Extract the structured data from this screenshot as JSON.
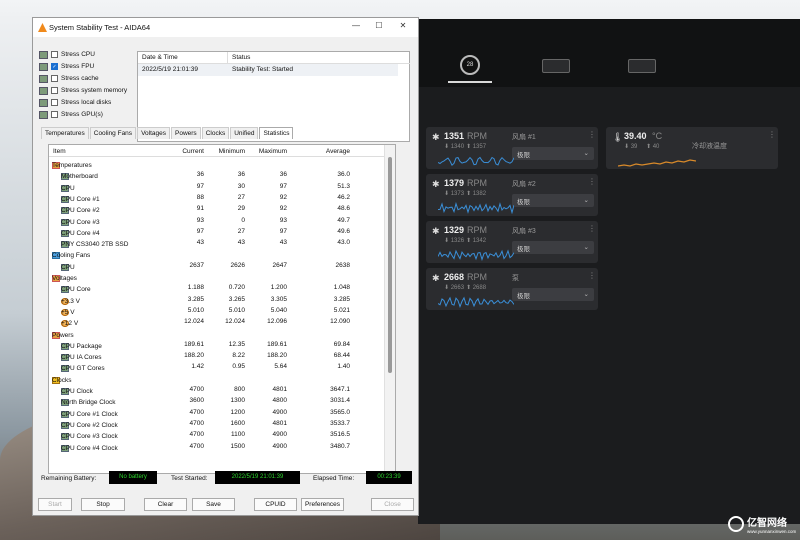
{
  "window": {
    "title": "System Stability Test - AIDA64",
    "min": "—",
    "max": "☐",
    "close": "✕"
  },
  "stress_options": [
    {
      "label": "Stress CPU",
      "checked": false
    },
    {
      "label": "Stress FPU",
      "checked": true
    },
    {
      "label": "Stress cache",
      "checked": false
    },
    {
      "label": "Stress system memory",
      "checked": false
    },
    {
      "label": "Stress local disks",
      "checked": false
    },
    {
      "label": "Stress GPU(s)",
      "checked": false
    }
  ],
  "status_table": {
    "h_date": "Date & Time",
    "h_status": "Status",
    "date": "2022/5/19 21:01:39",
    "status": "Stability Test: Started"
  },
  "tabs": [
    "Temperatures",
    "Cooling Fans",
    "Voltages",
    "Powers",
    "Clocks",
    "Unified",
    "Statistics"
  ],
  "active_tab": "Statistics",
  "grid_headers": {
    "item": "Item",
    "current": "Current",
    "minimum": "Minimum",
    "maximum": "Maximum",
    "average": "Average"
  },
  "rows": [
    {
      "kind": "section",
      "icon": "thermometer-icon",
      "name": "Temperatures"
    },
    {
      "kind": "item",
      "icon": "motherboard-icon",
      "name": "Motherboard",
      "cur": "36",
      "min": "36",
      "max": "36",
      "avg": "36.0"
    },
    {
      "kind": "item",
      "icon": "cpu-icon",
      "name": "CPU",
      "cur": "97",
      "min": "30",
      "max": "97",
      "avg": "51.3"
    },
    {
      "kind": "item",
      "icon": "cpu-icon",
      "name": "CPU Core #1",
      "cur": "88",
      "min": "27",
      "max": "92",
      "avg": "46.2"
    },
    {
      "kind": "item",
      "icon": "cpu-icon",
      "name": "CPU Core #2",
      "cur": "91",
      "min": "29",
      "max": "92",
      "avg": "48.6"
    },
    {
      "kind": "item",
      "icon": "cpu-icon",
      "name": "CPU Core #3",
      "cur": "93",
      "min": "0",
      "max": "93",
      "avg": "49.7"
    },
    {
      "kind": "item",
      "icon": "cpu-icon",
      "name": "CPU Core #4",
      "cur": "97",
      "min": "27",
      "max": "97",
      "avg": "49.6"
    },
    {
      "kind": "item",
      "icon": "drive-icon",
      "name": "PNY CS3040 2TB SSD",
      "cur": "43",
      "min": "43",
      "max": "43",
      "avg": "43.0"
    },
    {
      "kind": "section",
      "icon": "fan-icon",
      "name": "Cooling Fans"
    },
    {
      "kind": "item",
      "icon": "cpu-icon",
      "name": "CPU",
      "cur": "2637",
      "min": "2626",
      "max": "2647",
      "avg": "2638"
    },
    {
      "kind": "section",
      "icon": "voltage-icon",
      "name": "Voltages"
    },
    {
      "kind": "item",
      "icon": "cpu-icon",
      "name": "CPU Core",
      "cur": "1.188",
      "min": "0.720",
      "max": "1.200",
      "avg": "1.048"
    },
    {
      "kind": "item",
      "icon": "voltage-icon",
      "name": "+3.3 V",
      "cur": "3.285",
      "min": "3.265",
      "max": "3.305",
      "avg": "3.285"
    },
    {
      "kind": "item",
      "icon": "voltage-icon",
      "name": "+5 V",
      "cur": "5.010",
      "min": "5.010",
      "max": "5.040",
      "avg": "5.021"
    },
    {
      "kind": "item",
      "icon": "voltage-icon",
      "name": "+12 V",
      "cur": "12.024",
      "min": "12.024",
      "max": "12.096",
      "avg": "12.090"
    },
    {
      "kind": "section",
      "icon": "power-icon",
      "name": "Powers"
    },
    {
      "kind": "item",
      "icon": "cpu-icon",
      "name": "CPU Package",
      "cur": "189.61",
      "min": "12.35",
      "max": "189.61",
      "avg": "69.84"
    },
    {
      "kind": "item",
      "icon": "cpu-icon",
      "name": "CPU IA Cores",
      "cur": "188.20",
      "min": "8.22",
      "max": "188.20",
      "avg": "68.44"
    },
    {
      "kind": "item",
      "icon": "gpu-icon",
      "name": "CPU GT Cores",
      "cur": "1.42",
      "min": "0.95",
      "max": "5.64",
      "avg": "1.40"
    },
    {
      "kind": "section",
      "icon": "clock-icon",
      "name": "Clocks"
    },
    {
      "kind": "item",
      "icon": "cpu-icon",
      "name": "CPU Clock",
      "cur": "4700",
      "min": "800",
      "max": "4801",
      "avg": "3647.1"
    },
    {
      "kind": "item",
      "icon": "cpu-icon",
      "name": "North Bridge Clock",
      "cur": "3600",
      "min": "1300",
      "max": "4800",
      "avg": "3031.4"
    },
    {
      "kind": "item",
      "icon": "cpu-icon",
      "name": "CPU Core #1 Clock",
      "cur": "4700",
      "min": "1200",
      "max": "4900",
      "avg": "3565.0"
    },
    {
      "kind": "item",
      "icon": "cpu-icon",
      "name": "CPU Core #2 Clock",
      "cur": "4700",
      "min": "1600",
      "max": "4801",
      "avg": "3533.7"
    },
    {
      "kind": "item",
      "icon": "cpu-icon",
      "name": "CPU Core #3 Clock",
      "cur": "4700",
      "min": "1100",
      "max": "4900",
      "avg": "3516.5"
    },
    {
      "kind": "item",
      "icon": "cpu-icon",
      "name": "CPU Core #4 Clock",
      "cur": "4700",
      "min": "1500",
      "max": "4900",
      "avg": "3480.7"
    }
  ],
  "bottom": {
    "battery_label": "Remaining Battery:",
    "battery_value": "No battery",
    "started_label": "Test Started:",
    "started_value": "2022/5/19 21:01:39",
    "elapsed_label": "Elapsed Time:",
    "elapsed_value": "00:23:39"
  },
  "buttons": {
    "start": "Start",
    "stop": "Stop",
    "clear": "Clear",
    "save": "Save",
    "cpuid": "CPUID",
    "preferences": "Preferences",
    "close": "Close"
  },
  "panel": {
    "hub_badge": "28",
    "fans": [
      {
        "rpm": "1351",
        "unit": "RPM",
        "min": "⬇ 1340",
        "max": "⬆ 1357",
        "name": "风扇 #1",
        "mode": "极限"
      },
      {
        "rpm": "1379",
        "unit": "RPM",
        "min": "⬇ 1373",
        "max": "⬆ 1382",
        "name": "风扇 #2",
        "mode": "极限"
      },
      {
        "rpm": "1329",
        "unit": "RPM",
        "min": "⬇ 1326",
        "max": "⬆ 1342",
        "name": "风扇 #3",
        "mode": "极限"
      },
      {
        "rpm": "2668",
        "unit": "RPM",
        "min": "⬇ 2663",
        "max": "⬆ 2688",
        "name": "泵",
        "mode": "极限"
      }
    ],
    "temp": {
      "value": "39.40",
      "unit": "°C",
      "min": "⬇ 39",
      "max": "⬆ 40",
      "name": "冷却液温度"
    },
    "menu_glyph": "⋮",
    "chevron": "⌄"
  },
  "watermark": {
    "brand": "亿智网络",
    "sub": "www.yunnanxinwen.com"
  }
}
